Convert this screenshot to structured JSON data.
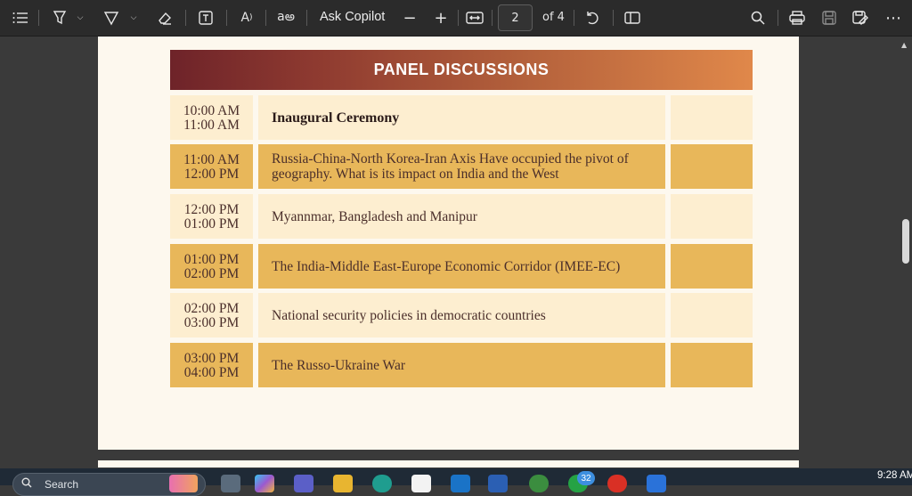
{
  "toolbar": {
    "ask_copilot_label": "Ask Copilot",
    "page_current": "2",
    "page_total_label": "of 4",
    "icons": [
      "contents-icon",
      "highlight-icon",
      "draw-icon",
      "eraser-icon",
      "text-box-icon",
      "read-aloud-icon",
      "translate-icon",
      "zoom-out-icon",
      "zoom-in-icon",
      "fit-width-icon",
      "rotate-icon",
      "page-view-icon",
      "search-icon",
      "print-icon",
      "save-icon",
      "save-as-icon",
      "more-icon"
    ]
  },
  "document": {
    "banner_title": "PANEL DISCUSSIONS",
    "sessions": [
      {
        "start": "10:00 AM",
        "end": "11:00 AM",
        "topic": "Inaugural Ceremony",
        "shade": "light"
      },
      {
        "start": "11:00 AM",
        "end": "12:00 PM",
        "topic": "Russia-China-North Korea-Iran Axis Have occupied the pivot of geography. What is its impact on India and the West",
        "shade": "dark"
      },
      {
        "start": "12:00 PM",
        "end": "01:00 PM",
        "topic": "Myannmar, Bangladesh and Manipur",
        "shade": "light"
      },
      {
        "start": "01:00 PM",
        "end": "02:00 PM",
        "topic": "The India-Middle East-Europe Economic Corridor (IMEE-EC)",
        "shade": "dark"
      },
      {
        "start": "02:00 PM",
        "end": "03:00 PM",
        "topic": "National security policies in democratic countries",
        "shade": "light"
      },
      {
        "start": "03:00 PM",
        "end": "04:00 PM",
        "topic": "The Russo-Ukraine War",
        "shade": "dark"
      }
    ],
    "colors": {
      "light_row": "#fdeed0",
      "dark_row": "#e8b75a",
      "banner_start": "#6e2329",
      "banner_end": "#e0884a"
    }
  },
  "taskbar": {
    "search_placeholder": "Search",
    "notification_badge": "32",
    "clock_time": "9:28 AM"
  }
}
